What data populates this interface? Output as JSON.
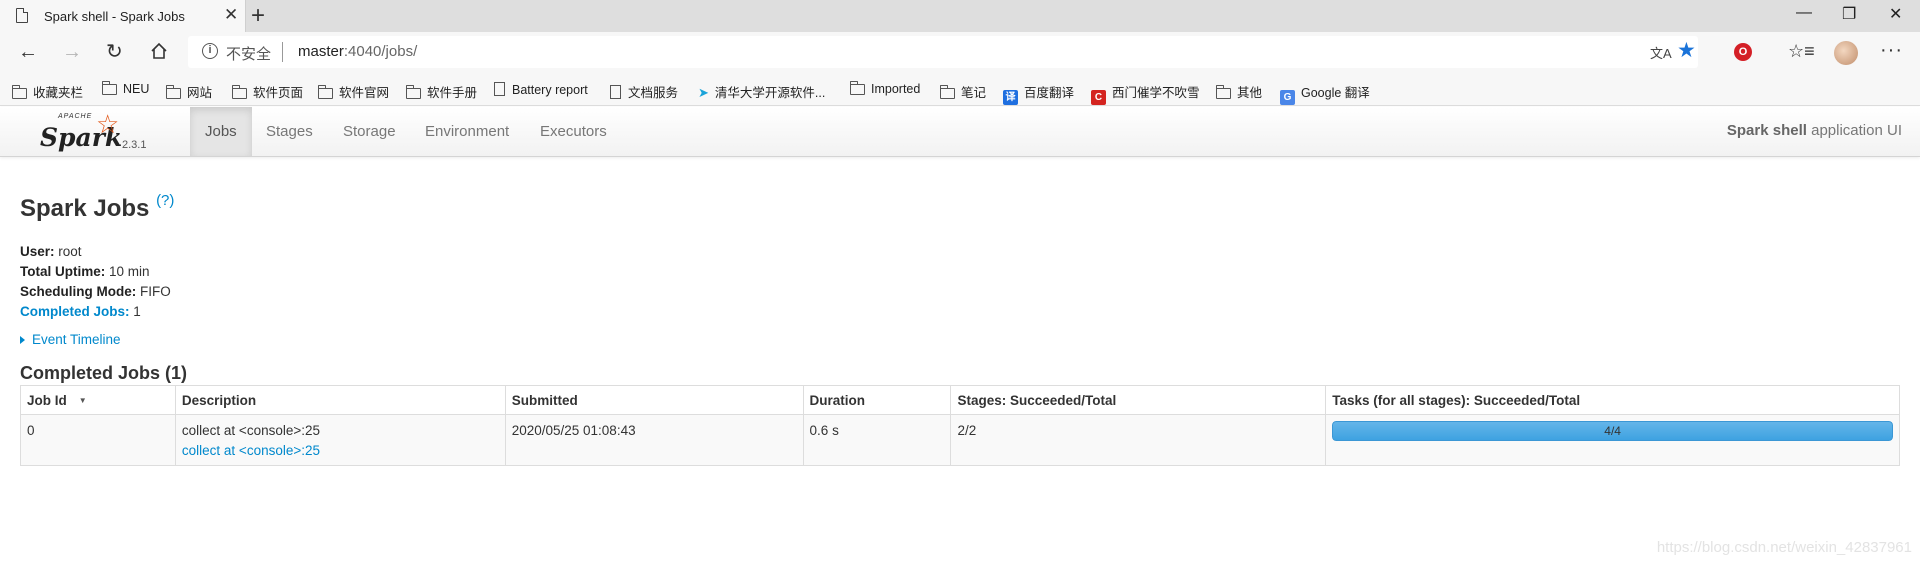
{
  "browser": {
    "tab_title": "Spark shell - Spark Jobs",
    "tab_close": "✕",
    "new_tab": "+",
    "window_controls": [
      "—",
      "❐",
      "✕"
    ],
    "security_label": "不安全",
    "url_host": "master",
    "url_rest": ":4040/jobs/",
    "bookmarks": [
      {
        "icon": "folder-icon",
        "label": "收藏夹栏"
      },
      {
        "icon": "folder-icon",
        "label": "NEU"
      },
      {
        "icon": "folder-icon",
        "label": "网站"
      },
      {
        "icon": "folder-icon",
        "label": "软件页面"
      },
      {
        "icon": "folder-icon",
        "label": "软件官网"
      },
      {
        "icon": "folder-icon",
        "label": "软件手册"
      },
      {
        "icon": "document-icon",
        "label": "Battery report"
      },
      {
        "icon": "document-icon",
        "label": "文档服务"
      },
      {
        "icon": "bird-icon",
        "label": "清华大学开源软件..."
      },
      {
        "icon": "folder-icon",
        "label": "Imported"
      },
      {
        "icon": "folder-icon",
        "label": "笔记"
      },
      {
        "icon": "translate-icon",
        "label": "百度翻译"
      },
      {
        "icon": "c-icon",
        "label": "西门催学不吹雪"
      },
      {
        "icon": "folder-icon",
        "label": "其他"
      },
      {
        "icon": "google-translate-icon",
        "label": "Google 翻译"
      }
    ]
  },
  "spark": {
    "logo_apache": "APACHE",
    "logo_word": "Spark",
    "version": "2.3.1",
    "nav": [
      "Jobs",
      "Stages",
      "Storage",
      "Environment",
      "Executors"
    ],
    "active_tab": "Jobs",
    "app_name": "Spark shell",
    "app_suffix": " application UI"
  },
  "page": {
    "title": "Spark Jobs",
    "help": "(?)",
    "summary": {
      "user_label": "User:",
      "user": " root",
      "uptime_label": "Total Uptime:",
      "uptime": " 10 min",
      "mode_label": "Scheduling Mode:",
      "mode": " FIFO",
      "completed_label": "Completed Jobs:",
      "completed": " 1"
    },
    "event_timeline": "Event Timeline",
    "completed_header": "Completed Jobs (1)",
    "table": {
      "headers": [
        "Job Id",
        "Description",
        "Submitted",
        "Duration",
        "Stages: Succeeded/Total",
        "Tasks (for all stages): Succeeded/Total"
      ],
      "sort_indicator": "▼",
      "rows": [
        {
          "job_id": "0",
          "description": "collect at <console>:25",
          "description_link": "collect at <console>:25",
          "submitted": "2020/05/25 01:08:43",
          "duration": "0.6 s",
          "stages": "2/2",
          "tasks_label": "4/4",
          "tasks_fraction": 1.0
        }
      ]
    }
  },
  "watermark": "https://blog.csdn.net/weixin_42837961"
}
